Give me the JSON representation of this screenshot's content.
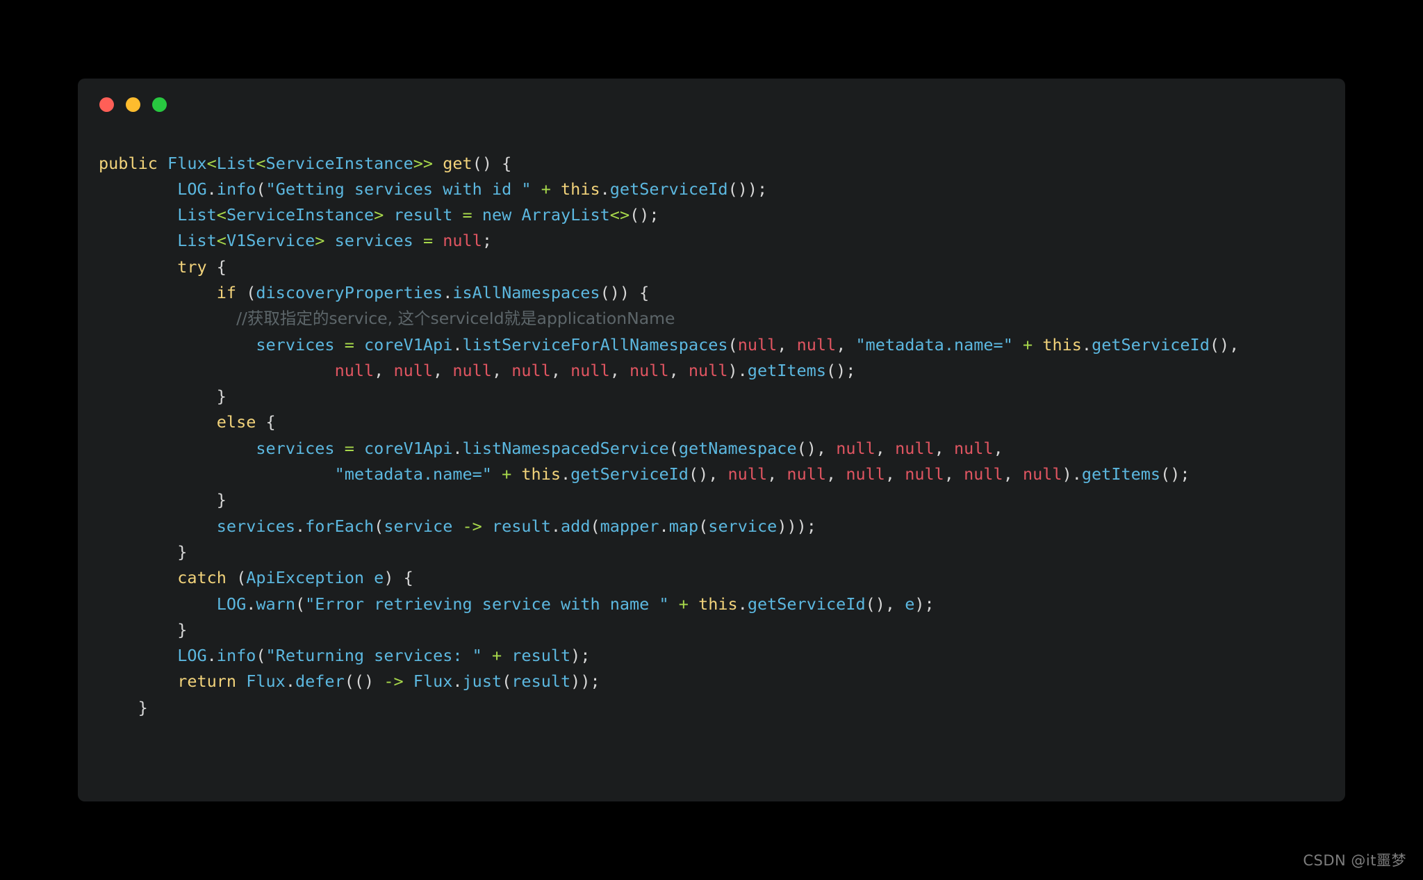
{
  "page": {
    "background_color": "#000000",
    "watermark": "CSDN @it噩梦"
  },
  "code_window": {
    "background_color": "#1b1d1e",
    "traffic_lights": [
      {
        "name": "close",
        "color": "#ff5f57"
      },
      {
        "name": "minimize",
        "color": "#febc2e"
      },
      {
        "name": "maximize",
        "color": "#28c840"
      }
    ],
    "language": "java",
    "theme_colors": {
      "keyword": "#f2d37b",
      "identifier": "#5cb8e0",
      "string": "#5cb8e0",
      "operator": "#a8d94b",
      "null_literal": "#e05561",
      "punctuation": "#d8d8d8",
      "comment": "#5d666a"
    },
    "code_lines": [
      {
        "indent": 0,
        "tokens": [
          {
            "t": "public",
            "c": "kw"
          },
          {
            "t": " ",
            "c": "pun"
          },
          {
            "t": "Flux",
            "c": "typ"
          },
          {
            "t": "<",
            "c": "op"
          },
          {
            "t": "List",
            "c": "typ"
          },
          {
            "t": "<",
            "c": "op"
          },
          {
            "t": "ServiceInstance",
            "c": "typ"
          },
          {
            "t": ">>",
            "c": "op"
          },
          {
            "t": " ",
            "c": "pun"
          },
          {
            "t": "get",
            "c": "kw"
          },
          {
            "t": "() {",
            "c": "pun"
          }
        ]
      },
      {
        "indent": 0,
        "tokens": [
          {
            "t": "        ",
            "c": "pun"
          },
          {
            "t": "LOG",
            "c": "typ"
          },
          {
            "t": ".",
            "c": "pun"
          },
          {
            "t": "info",
            "c": "id"
          },
          {
            "t": "(",
            "c": "pun"
          },
          {
            "t": "\"Getting services with id \"",
            "c": "str"
          },
          {
            "t": " ",
            "c": "pun"
          },
          {
            "t": "+",
            "c": "op"
          },
          {
            "t": " ",
            "c": "pun"
          },
          {
            "t": "this",
            "c": "kw"
          },
          {
            "t": ".",
            "c": "pun"
          },
          {
            "t": "getServiceId",
            "c": "id"
          },
          {
            "t": "());",
            "c": "pun"
          }
        ]
      },
      {
        "indent": 0,
        "tokens": [
          {
            "t": "        ",
            "c": "pun"
          },
          {
            "t": "List",
            "c": "typ"
          },
          {
            "t": "<",
            "c": "op"
          },
          {
            "t": "ServiceInstance",
            "c": "typ"
          },
          {
            "t": ">",
            "c": "op"
          },
          {
            "t": " ",
            "c": "pun"
          },
          {
            "t": "result",
            "c": "id"
          },
          {
            "t": " ",
            "c": "pun"
          },
          {
            "t": "=",
            "c": "op"
          },
          {
            "t": " ",
            "c": "pun"
          },
          {
            "t": "new",
            "c": "id"
          },
          {
            "t": " ",
            "c": "pun"
          },
          {
            "t": "ArrayList",
            "c": "typ"
          },
          {
            "t": "<>",
            "c": "op"
          },
          {
            "t": "();",
            "c": "pun"
          }
        ]
      },
      {
        "indent": 0,
        "tokens": [
          {
            "t": "        ",
            "c": "pun"
          },
          {
            "t": "List",
            "c": "typ"
          },
          {
            "t": "<",
            "c": "op"
          },
          {
            "t": "V1Service",
            "c": "typ"
          },
          {
            "t": ">",
            "c": "op"
          },
          {
            "t": " ",
            "c": "pun"
          },
          {
            "t": "services",
            "c": "id"
          },
          {
            "t": " ",
            "c": "pun"
          },
          {
            "t": "=",
            "c": "op"
          },
          {
            "t": " ",
            "c": "pun"
          },
          {
            "t": "null",
            "c": "nul"
          },
          {
            "t": ";",
            "c": "pun"
          }
        ]
      },
      {
        "indent": 0,
        "tokens": [
          {
            "t": "        ",
            "c": "pun"
          },
          {
            "t": "try",
            "c": "kw"
          },
          {
            "t": " {",
            "c": "pun"
          }
        ]
      },
      {
        "indent": 0,
        "tokens": [
          {
            "t": "            ",
            "c": "pun"
          },
          {
            "t": "if",
            "c": "kw"
          },
          {
            "t": " (",
            "c": "pun"
          },
          {
            "t": "discoveryProperties",
            "c": "id"
          },
          {
            "t": ".",
            "c": "pun"
          },
          {
            "t": "isAllNamespaces",
            "c": "id"
          },
          {
            "t": "()) {",
            "c": "pun"
          }
        ]
      },
      {
        "indent": 0,
        "tokens": [
          {
            "t": "              ",
            "c": "pun"
          },
          {
            "t": "//获取指定的service, 这个serviceId就是applicationName",
            "c": "cmt"
          }
        ]
      },
      {
        "indent": 0,
        "tokens": [
          {
            "t": "                ",
            "c": "pun"
          },
          {
            "t": "services",
            "c": "id"
          },
          {
            "t": " ",
            "c": "pun"
          },
          {
            "t": "=",
            "c": "op"
          },
          {
            "t": " ",
            "c": "pun"
          },
          {
            "t": "coreV1Api",
            "c": "id"
          },
          {
            "t": ".",
            "c": "pun"
          },
          {
            "t": "listServiceForAllNamespaces",
            "c": "id"
          },
          {
            "t": "(",
            "c": "pun"
          },
          {
            "t": "null",
            "c": "nul"
          },
          {
            "t": ", ",
            "c": "pun"
          },
          {
            "t": "null",
            "c": "nul"
          },
          {
            "t": ", ",
            "c": "pun"
          },
          {
            "t": "\"metadata.name=\"",
            "c": "str"
          },
          {
            "t": " ",
            "c": "pun"
          },
          {
            "t": "+",
            "c": "op"
          },
          {
            "t": " ",
            "c": "pun"
          },
          {
            "t": "this",
            "c": "kw"
          },
          {
            "t": ".",
            "c": "pun"
          },
          {
            "t": "getServiceId",
            "c": "id"
          },
          {
            "t": "(),",
            "c": "pun"
          }
        ]
      },
      {
        "indent": 0,
        "tokens": [
          {
            "t": "                        ",
            "c": "pun"
          },
          {
            "t": "null",
            "c": "nul"
          },
          {
            "t": ", ",
            "c": "pun"
          },
          {
            "t": "null",
            "c": "nul"
          },
          {
            "t": ", ",
            "c": "pun"
          },
          {
            "t": "null",
            "c": "nul"
          },
          {
            "t": ", ",
            "c": "pun"
          },
          {
            "t": "null",
            "c": "nul"
          },
          {
            "t": ", ",
            "c": "pun"
          },
          {
            "t": "null",
            "c": "nul"
          },
          {
            "t": ", ",
            "c": "pun"
          },
          {
            "t": "null",
            "c": "nul"
          },
          {
            "t": ", ",
            "c": "pun"
          },
          {
            "t": "null",
            "c": "nul"
          },
          {
            "t": ").",
            "c": "pun"
          },
          {
            "t": "getItems",
            "c": "id"
          },
          {
            "t": "();",
            "c": "pun"
          }
        ]
      },
      {
        "indent": 0,
        "tokens": [
          {
            "t": "            }",
            "c": "pun"
          }
        ]
      },
      {
        "indent": 0,
        "tokens": [
          {
            "t": "            ",
            "c": "pun"
          },
          {
            "t": "else",
            "c": "kw"
          },
          {
            "t": " {",
            "c": "pun"
          }
        ]
      },
      {
        "indent": 0,
        "tokens": [
          {
            "t": "                ",
            "c": "pun"
          },
          {
            "t": "services",
            "c": "id"
          },
          {
            "t": " ",
            "c": "pun"
          },
          {
            "t": "=",
            "c": "op"
          },
          {
            "t": " ",
            "c": "pun"
          },
          {
            "t": "coreV1Api",
            "c": "id"
          },
          {
            "t": ".",
            "c": "pun"
          },
          {
            "t": "listNamespacedService",
            "c": "id"
          },
          {
            "t": "(",
            "c": "pun"
          },
          {
            "t": "getNamespace",
            "c": "id"
          },
          {
            "t": "(), ",
            "c": "pun"
          },
          {
            "t": "null",
            "c": "nul"
          },
          {
            "t": ", ",
            "c": "pun"
          },
          {
            "t": "null",
            "c": "nul"
          },
          {
            "t": ", ",
            "c": "pun"
          },
          {
            "t": "null",
            "c": "nul"
          },
          {
            "t": ",",
            "c": "pun"
          }
        ]
      },
      {
        "indent": 0,
        "tokens": [
          {
            "t": "                        ",
            "c": "pun"
          },
          {
            "t": "\"metadata.name=\"",
            "c": "str"
          },
          {
            "t": " ",
            "c": "pun"
          },
          {
            "t": "+",
            "c": "op"
          },
          {
            "t": " ",
            "c": "pun"
          },
          {
            "t": "this",
            "c": "kw"
          },
          {
            "t": ".",
            "c": "pun"
          },
          {
            "t": "getServiceId",
            "c": "id"
          },
          {
            "t": "(), ",
            "c": "pun"
          },
          {
            "t": "null",
            "c": "nul"
          },
          {
            "t": ", ",
            "c": "pun"
          },
          {
            "t": "null",
            "c": "nul"
          },
          {
            "t": ", ",
            "c": "pun"
          },
          {
            "t": "null",
            "c": "nul"
          },
          {
            "t": ", ",
            "c": "pun"
          },
          {
            "t": "null",
            "c": "nul"
          },
          {
            "t": ", ",
            "c": "pun"
          },
          {
            "t": "null",
            "c": "nul"
          },
          {
            "t": ", ",
            "c": "pun"
          },
          {
            "t": "null",
            "c": "nul"
          },
          {
            "t": ").",
            "c": "pun"
          },
          {
            "t": "getItems",
            "c": "id"
          },
          {
            "t": "();",
            "c": "pun"
          }
        ]
      },
      {
        "indent": 0,
        "tokens": [
          {
            "t": "            }",
            "c": "pun"
          }
        ]
      },
      {
        "indent": 0,
        "tokens": [
          {
            "t": "            ",
            "c": "pun"
          },
          {
            "t": "services",
            "c": "id"
          },
          {
            "t": ".",
            "c": "pun"
          },
          {
            "t": "forEach",
            "c": "id"
          },
          {
            "t": "(",
            "c": "pun"
          },
          {
            "t": "service",
            "c": "id"
          },
          {
            "t": " ",
            "c": "pun"
          },
          {
            "t": "->",
            "c": "op"
          },
          {
            "t": " ",
            "c": "pun"
          },
          {
            "t": "result",
            "c": "id"
          },
          {
            "t": ".",
            "c": "pun"
          },
          {
            "t": "add",
            "c": "id"
          },
          {
            "t": "(",
            "c": "pun"
          },
          {
            "t": "mapper",
            "c": "id"
          },
          {
            "t": ".",
            "c": "pun"
          },
          {
            "t": "map",
            "c": "id"
          },
          {
            "t": "(",
            "c": "pun"
          },
          {
            "t": "service",
            "c": "id"
          },
          {
            "t": ")));",
            "c": "pun"
          }
        ]
      },
      {
        "indent": 0,
        "tokens": [
          {
            "t": "        }",
            "c": "pun"
          }
        ]
      },
      {
        "indent": 0,
        "tokens": [
          {
            "t": "        ",
            "c": "pun"
          },
          {
            "t": "catch",
            "c": "kw"
          },
          {
            "t": " (",
            "c": "pun"
          },
          {
            "t": "ApiException",
            "c": "typ"
          },
          {
            "t": " ",
            "c": "pun"
          },
          {
            "t": "e",
            "c": "id"
          },
          {
            "t": ") {",
            "c": "pun"
          }
        ]
      },
      {
        "indent": 0,
        "tokens": [
          {
            "t": "            ",
            "c": "pun"
          },
          {
            "t": "LOG",
            "c": "typ"
          },
          {
            "t": ".",
            "c": "pun"
          },
          {
            "t": "warn",
            "c": "id"
          },
          {
            "t": "(",
            "c": "pun"
          },
          {
            "t": "\"Error retrieving service with name \"",
            "c": "str"
          },
          {
            "t": " ",
            "c": "pun"
          },
          {
            "t": "+",
            "c": "op"
          },
          {
            "t": " ",
            "c": "pun"
          },
          {
            "t": "this",
            "c": "kw"
          },
          {
            "t": ".",
            "c": "pun"
          },
          {
            "t": "getServiceId",
            "c": "id"
          },
          {
            "t": "(), ",
            "c": "pun"
          },
          {
            "t": "e",
            "c": "id"
          },
          {
            "t": ");",
            "c": "pun"
          }
        ]
      },
      {
        "indent": 0,
        "tokens": [
          {
            "t": "        }",
            "c": "pun"
          }
        ]
      },
      {
        "indent": 0,
        "tokens": [
          {
            "t": "        ",
            "c": "pun"
          },
          {
            "t": "LOG",
            "c": "typ"
          },
          {
            "t": ".",
            "c": "pun"
          },
          {
            "t": "info",
            "c": "id"
          },
          {
            "t": "(",
            "c": "pun"
          },
          {
            "t": "\"Returning services: \"",
            "c": "str"
          },
          {
            "t": " ",
            "c": "pun"
          },
          {
            "t": "+",
            "c": "op"
          },
          {
            "t": " ",
            "c": "pun"
          },
          {
            "t": "result",
            "c": "id"
          },
          {
            "t": ");",
            "c": "pun"
          }
        ]
      },
      {
        "indent": 0,
        "tokens": [
          {
            "t": "        ",
            "c": "pun"
          },
          {
            "t": "return",
            "c": "kw"
          },
          {
            "t": " ",
            "c": "pun"
          },
          {
            "t": "Flux",
            "c": "typ"
          },
          {
            "t": ".",
            "c": "pun"
          },
          {
            "t": "defer",
            "c": "id"
          },
          {
            "t": "(() ",
            "c": "pun"
          },
          {
            "t": "->",
            "c": "op"
          },
          {
            "t": " ",
            "c": "pun"
          },
          {
            "t": "Flux",
            "c": "typ"
          },
          {
            "t": ".",
            "c": "pun"
          },
          {
            "t": "just",
            "c": "id"
          },
          {
            "t": "(",
            "c": "pun"
          },
          {
            "t": "result",
            "c": "id"
          },
          {
            "t": "));",
            "c": "pun"
          }
        ]
      },
      {
        "indent": 0,
        "tokens": [
          {
            "t": "    }",
            "c": "pun"
          }
        ]
      }
    ],
    "plain_text": "public Flux<List<ServiceInstance>> get() {\n        LOG.info(\"Getting services with id \" + this.getServiceId());\n        List<ServiceInstance> result = new ArrayList<>();\n        List<V1Service> services = null;\n        try {\n            if (discoveryProperties.isAllNamespaces()) {\n              //获取指定的service, 这个serviceId就是applicationName\n                services = coreV1Api.listServiceForAllNamespaces(null, null, \"metadata.name=\" + this.getServiceId(),\n                        null, null, null, null, null, null, null).getItems();\n            }\n            else {\n                services = coreV1Api.listNamespacedService(getNamespace(), null, null, null,\n                        \"metadata.name=\" + this.getServiceId(), null, null, null, null, null, null).getItems();\n            }\n            services.forEach(service -> result.add(mapper.map(service)));\n        }\n        catch (ApiException e) {\n            LOG.warn(\"Error retrieving service with name \" + this.getServiceId(), e);\n        }\n        LOG.info(\"Returning services: \" + result);\n        return Flux.defer(() -> Flux.just(result));\n    }"
  }
}
